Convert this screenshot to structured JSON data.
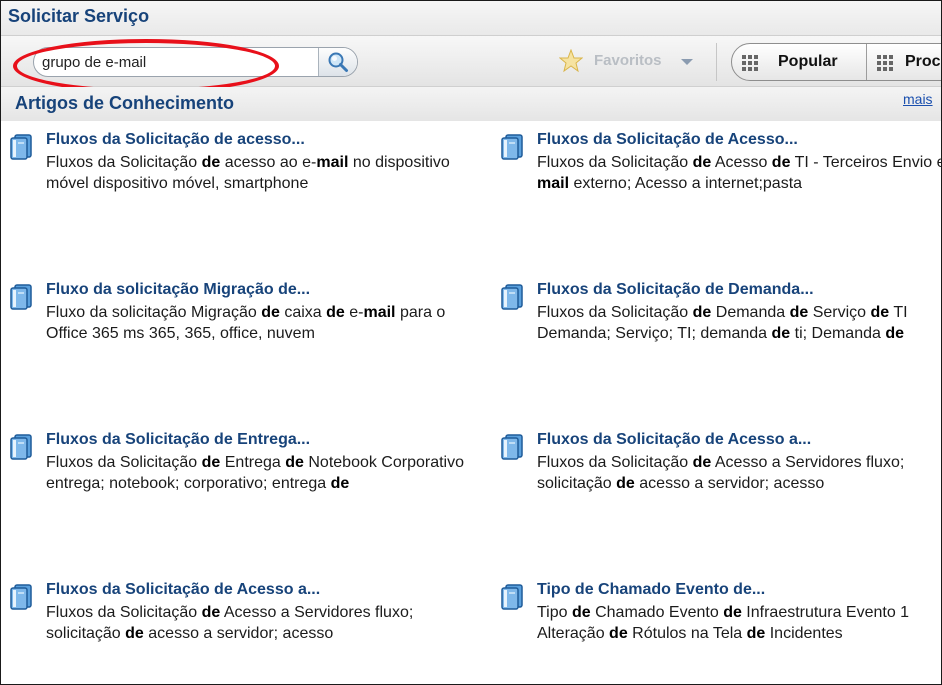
{
  "header": {
    "title": "Solicitar Serviço"
  },
  "search": {
    "value": "grupo de e-mail"
  },
  "favorites": {
    "label": "Favoritos"
  },
  "view_tabs": [
    {
      "label": "Popular"
    },
    {
      "label": "Proc"
    }
  ],
  "section": {
    "title": "Artigos de Conhecimento",
    "more": "mais"
  },
  "articles": [
    {
      "title": "Fluxos da Solicitação de acesso...",
      "lines": [
        [
          [
            "Fluxos da Solicitação ",
            false
          ],
          [
            "de",
            true
          ],
          [
            " acesso ao e-",
            false
          ],
          [
            "mail",
            true
          ],
          [
            " no dispositivo",
            false
          ]
        ],
        [
          [
            "móvel dispositivo móvel, smartphone",
            false
          ]
        ]
      ]
    },
    {
      "title": "Fluxos da Solicitação de Acesso...",
      "lines": [
        [
          [
            "Fluxos da Solicitação ",
            false
          ],
          [
            "de",
            true
          ],
          [
            " Acesso ",
            false
          ],
          [
            "de",
            true
          ],
          [
            " TI - Terceiros Envio e",
            false
          ]
        ],
        [
          [
            "mail",
            true
          ],
          [
            " externo; Acesso a internet;pasta",
            false
          ]
        ]
      ]
    },
    {
      "title": "Fluxo da solicitação Migração de...",
      "lines": [
        [
          [
            "Fluxo da solicitação Migração ",
            false
          ],
          [
            "de",
            true
          ],
          [
            " caixa ",
            false
          ],
          [
            "de",
            true
          ],
          [
            " e-",
            false
          ],
          [
            "mail",
            true
          ],
          [
            " para o",
            false
          ]
        ],
        [
          [
            "Office 365 ms 365, 365, office, nuvem",
            false
          ]
        ]
      ]
    },
    {
      "title": "Fluxos da Solicitação de Demanda...",
      "lines": [
        [
          [
            "Fluxos da Solicitação ",
            false
          ],
          [
            "de",
            true
          ],
          [
            " Demanda ",
            false
          ],
          [
            "de",
            true
          ],
          [
            " Serviço ",
            false
          ],
          [
            "de",
            true
          ],
          [
            " TI",
            false
          ]
        ],
        [
          [
            "Demanda; Serviço; TI; demanda ",
            false
          ],
          [
            "de",
            true
          ],
          [
            " ti; Demanda ",
            false
          ],
          [
            "de",
            true
          ]
        ]
      ]
    },
    {
      "title": "Fluxos da Solicitação de Entrega...",
      "lines": [
        [
          [
            "Fluxos da Solicitação ",
            false
          ],
          [
            "de",
            true
          ],
          [
            " Entrega ",
            false
          ],
          [
            "de",
            true
          ],
          [
            " Notebook Corporativo",
            false
          ]
        ],
        [
          [
            "entrega; notebook; corporativo; entrega ",
            false
          ],
          [
            "de",
            true
          ]
        ]
      ]
    },
    {
      "title": "Fluxos da Solicitação de Acesso a...",
      "lines": [
        [
          [
            "Fluxos da Solicitação ",
            false
          ],
          [
            "de",
            true
          ],
          [
            " Acesso a Servidores fluxo;",
            false
          ]
        ],
        [
          [
            "solicitação ",
            false
          ],
          [
            "de",
            true
          ],
          [
            " acesso a servidor; acesso",
            false
          ]
        ]
      ]
    },
    {
      "title": "Fluxos da Solicitação de Acesso a...",
      "lines": [
        [
          [
            "Fluxos da Solicitação ",
            false
          ],
          [
            "de",
            true
          ],
          [
            " Acesso a Servidores fluxo;",
            false
          ]
        ],
        [
          [
            "solicitação ",
            false
          ],
          [
            "de",
            true
          ],
          [
            " acesso a servidor; acesso",
            false
          ]
        ]
      ]
    },
    {
      "title": "Tipo de Chamado Evento de...",
      "lines": [
        [
          [
            "Tipo ",
            false
          ],
          [
            "de",
            true
          ],
          [
            " Chamado Evento ",
            false
          ],
          [
            "de",
            true
          ],
          [
            " Infraestrutura Evento 1",
            false
          ]
        ],
        [
          [
            "Alteração ",
            false
          ],
          [
            "de",
            true
          ],
          [
            " Rótulos na Tela ",
            false
          ],
          [
            "de",
            true
          ],
          [
            " Incidentes",
            false
          ]
        ]
      ]
    }
  ]
}
